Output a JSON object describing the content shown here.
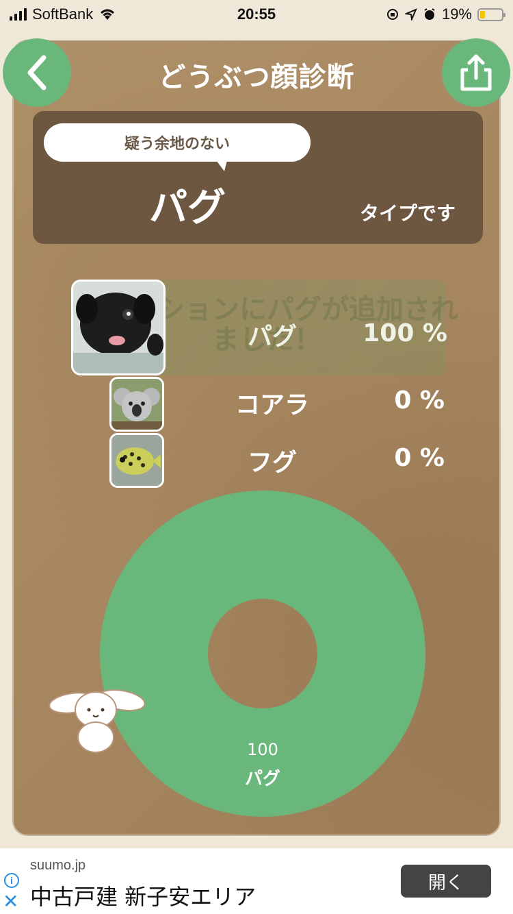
{
  "status_bar": {
    "carrier": "SoftBank",
    "time": "20:55",
    "battery": "19%",
    "battery_level": 0.19
  },
  "header": {
    "title": "どうぶつ顔診断",
    "back_icon": "chevron-left-icon",
    "share_icon": "share-icon"
  },
  "result": {
    "prefix": "疑う余地のない",
    "animal": "パグ",
    "suffix": "タイプです"
  },
  "collection_message": "コレクションにパグが追加されました！",
  "ranking": [
    {
      "name": "パグ",
      "percent": "100 %",
      "image": "pug-photo"
    },
    {
      "name": "コアラ",
      "percent": "0 %",
      "image": "koala-photo"
    },
    {
      "name": "フグ",
      "percent": "0 %",
      "image": "pufferfish-photo"
    }
  ],
  "chart_data": {
    "type": "pie",
    "style": "donut",
    "categories": [
      "パグ"
    ],
    "values": [
      100
    ],
    "labels": [
      "100",
      "パグ"
    ],
    "colors": [
      "#6ab77b"
    ]
  },
  "ad": {
    "domain": "suumo.jp",
    "title": "中古戸建 新子安エリア",
    "button": "開く",
    "info_icon": "info-icon",
    "close_icon": "close-icon"
  },
  "colors": {
    "accent_green": "#6ab77b",
    "panel_brown": "#6e5740",
    "paper": "#a78760"
  }
}
